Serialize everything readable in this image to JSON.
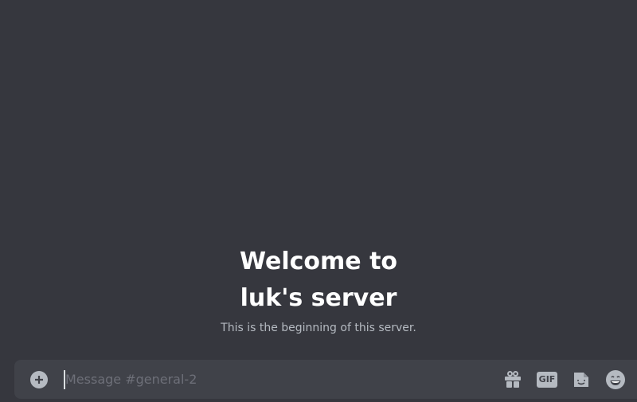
{
  "welcome": {
    "line1": "Welcome to",
    "line2": "luk's server",
    "subtitle": "This is the beginning of this server."
  },
  "composer": {
    "placeholder": "Message #general-2",
    "value": "",
    "gif_label": "GIF"
  },
  "icons": [
    "plus-circle-icon",
    "gift-icon",
    "gif-icon",
    "sticker-icon",
    "emoji-icon"
  ],
  "colors": {
    "background": "#36373e",
    "composer": "#404249",
    "icon": "#b5bac1"
  }
}
